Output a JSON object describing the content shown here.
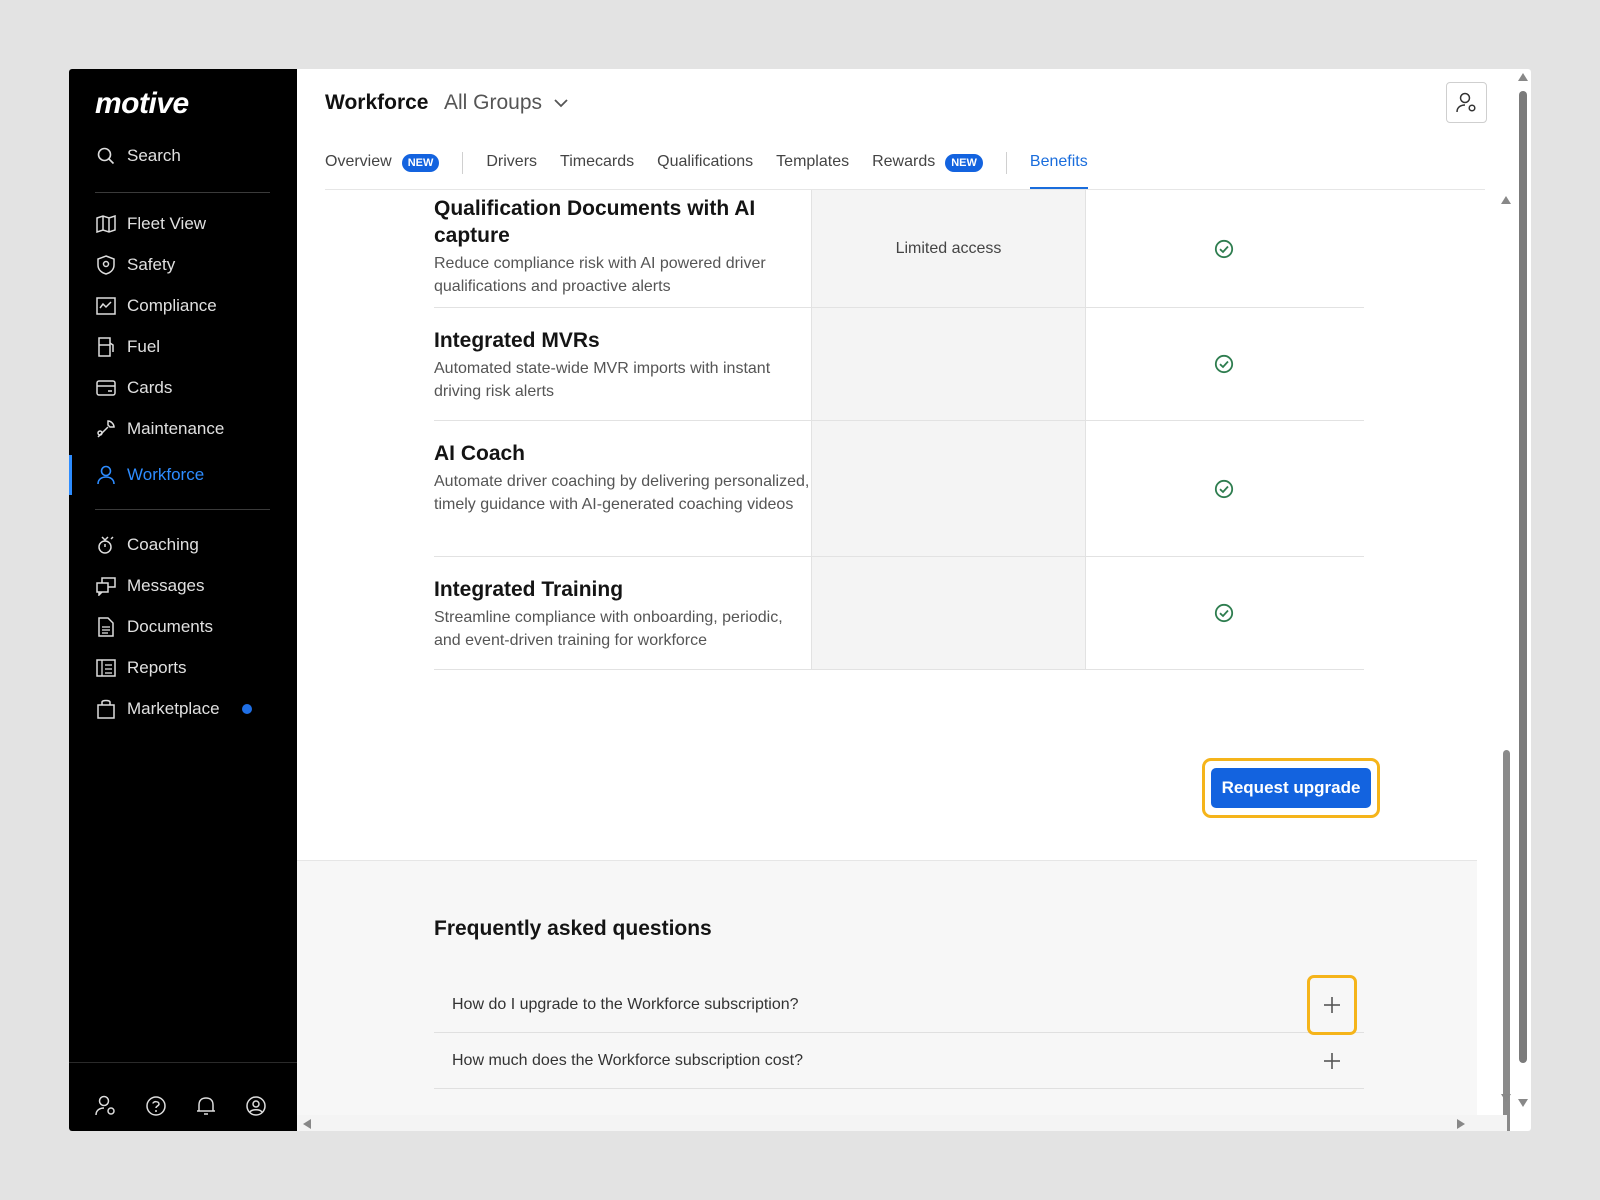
{
  "sidebar": {
    "logo": "motive",
    "search_label": "Search",
    "items": [
      {
        "label": "Fleet View",
        "icon": "map-icon"
      },
      {
        "label": "Safety",
        "icon": "shield-icon"
      },
      {
        "label": "Compliance",
        "icon": "compliance-icon"
      },
      {
        "label": "Fuel",
        "icon": "fuel-icon"
      },
      {
        "label": "Cards",
        "icon": "card-icon"
      },
      {
        "label": "Maintenance",
        "icon": "wrench-icon"
      },
      {
        "label": "Workforce",
        "icon": "person-icon",
        "active": true
      },
      {
        "label": "Coaching",
        "icon": "coaching-icon"
      },
      {
        "label": "Messages",
        "icon": "messages-icon"
      },
      {
        "label": "Documents",
        "icon": "document-icon"
      },
      {
        "label": "Reports",
        "icon": "reports-icon"
      },
      {
        "label": "Marketplace",
        "icon": "bag-icon",
        "notification_dot": true
      }
    ],
    "bottom_icons": [
      "user-settings-icon",
      "help-icon",
      "bell-icon",
      "account-icon"
    ]
  },
  "header": {
    "title": "Workforce",
    "group_selector": "All Groups"
  },
  "tabs": [
    {
      "label": "Overview",
      "badge": "NEW"
    },
    {
      "label": "Drivers"
    },
    {
      "label": "Timecards"
    },
    {
      "label": "Qualifications"
    },
    {
      "label": "Templates"
    },
    {
      "label": "Rewards",
      "badge": "NEW"
    },
    {
      "label": "Benefits",
      "active": true
    }
  ],
  "features": [
    {
      "title": "Qualification Documents with AI capture",
      "description": "Reduce compliance risk with AI powered driver qualifications and proactive alerts",
      "current_plan": "Limited access",
      "upgrade_plan": "included"
    },
    {
      "title": "Integrated MVRs",
      "description": "Automated state-wide MVR imports with instant driving risk alerts",
      "current_plan": "",
      "upgrade_plan": "included"
    },
    {
      "title": "AI Coach",
      "description": "Automate driver coaching by delivering personalized, timely guidance with AI-generated coaching videos",
      "current_plan": "",
      "upgrade_plan": "included"
    },
    {
      "title": "Integrated Training",
      "description": "Streamline compliance with onboarding, periodic, and event-driven training for workforce",
      "current_plan": "",
      "upgrade_plan": "included"
    }
  ],
  "upgrade_button": "Request upgrade",
  "faq": {
    "title": "Frequently asked questions",
    "questions": [
      "How do I upgrade to the Workforce subscription?",
      "How much does the Workforce subscription cost?"
    ]
  },
  "colors": {
    "accent": "#1363df",
    "active_nav": "#2d8cff",
    "check": "#2e7d4f",
    "highlight": "#f5b41a"
  }
}
